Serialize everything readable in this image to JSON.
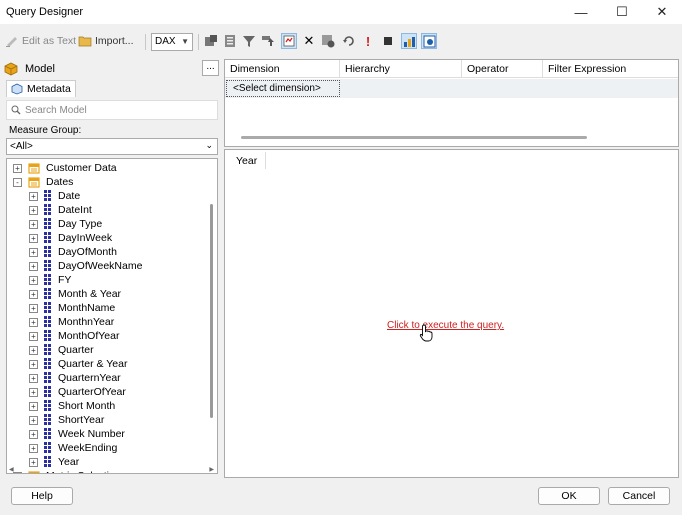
{
  "window": {
    "title": "Query Designer"
  },
  "toolbar": {
    "edit_as_text": "Edit as Text",
    "import": "Import...",
    "language": "DAX"
  },
  "left": {
    "model_label": "Model",
    "ellipsis": "...",
    "metadata_tab": "Metadata",
    "search_placeholder": "Search Model",
    "measure_group_label": "Measure Group:",
    "measure_group_value": "<All>",
    "tree": {
      "customer_data": "Customer Data",
      "dates": "Dates",
      "date_items": [
        "Date",
        "DateInt",
        "Day Type",
        "DayInWeek",
        "DayOfMonth",
        "DayOfWeekName",
        "FY",
        "Month & Year",
        "MonthName",
        "MonthnYear",
        "MonthOfYear",
        "Quarter",
        "Quarter & Year",
        "QuarternYear",
        "QuarterOfYear",
        "Short Month",
        "ShortYear",
        "Week Number",
        "WeekEnding",
        "Year"
      ],
      "metric_selection": "Metric Selection"
    }
  },
  "filter": {
    "columns": [
      "Dimension",
      "Hierarchy",
      "Operator",
      "Filter Expression"
    ],
    "select_dimension": "<Select dimension>"
  },
  "results": {
    "column": "Year",
    "execute_link": "Click to execute the query."
  },
  "buttons": {
    "help": "Help",
    "ok": "OK",
    "cancel": "Cancel"
  },
  "colors": {
    "link": "#d02020",
    "accent": "#1e5fa8",
    "dim_icon": "#2b2fa0",
    "table_icon": "#e8a317"
  }
}
